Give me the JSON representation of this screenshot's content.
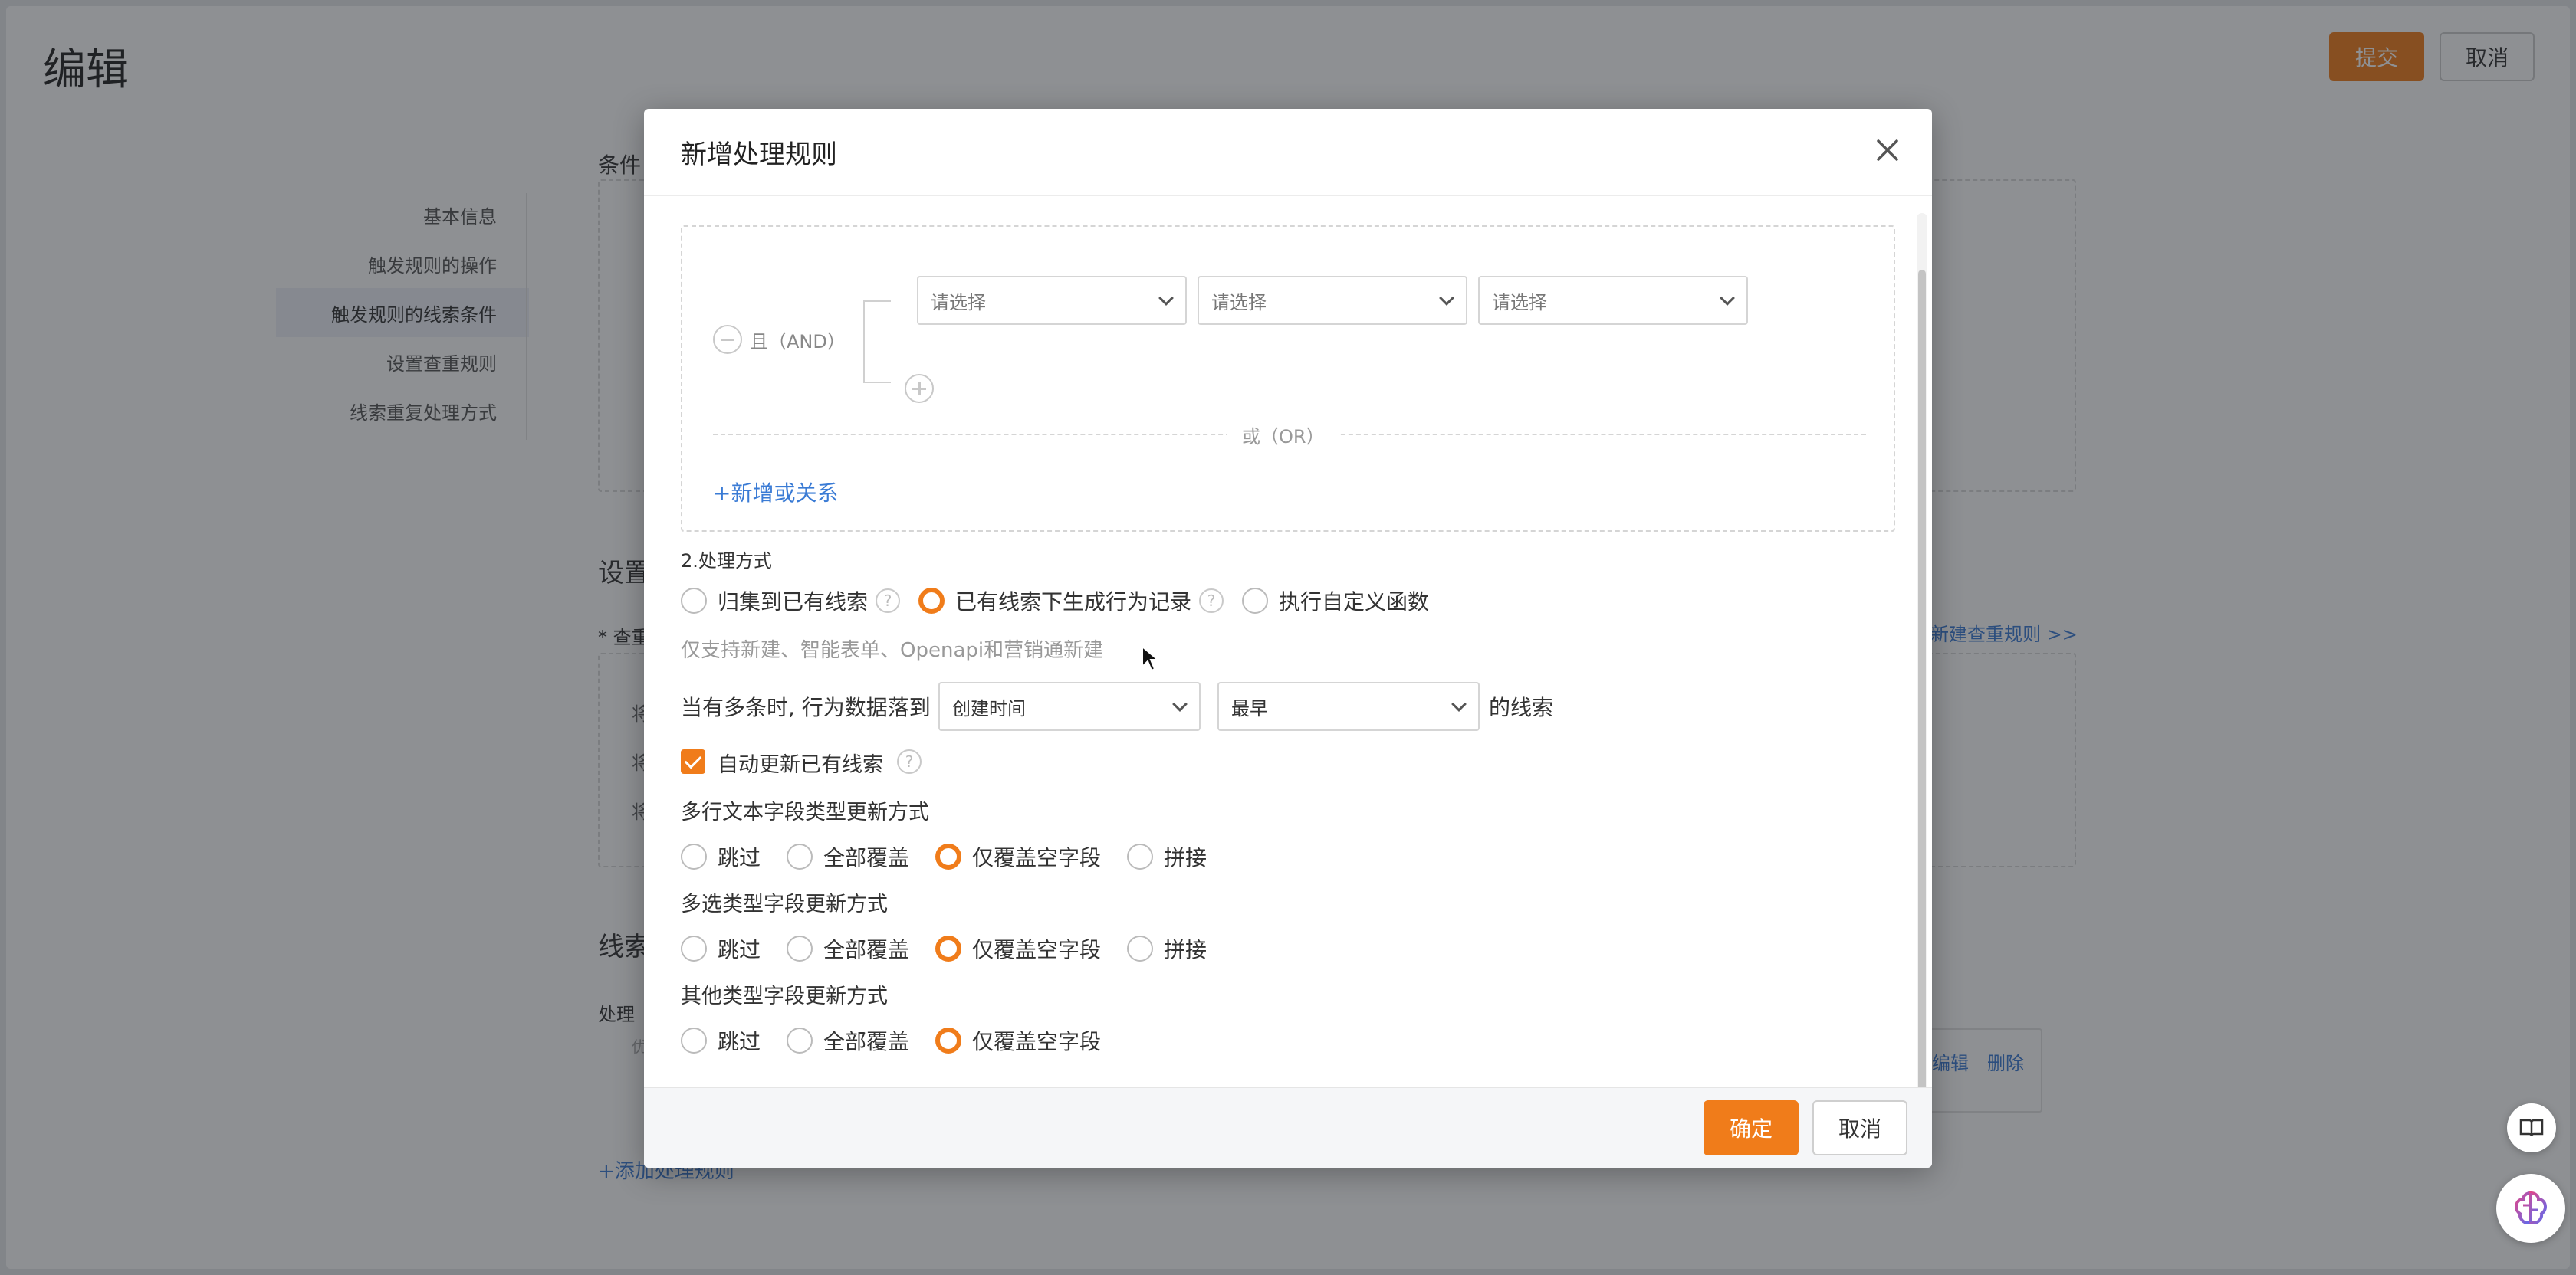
{
  "page": {
    "title": "编辑",
    "submit_label": "提交",
    "cancel_label": "取消"
  },
  "sidebar": {
    "items": [
      {
        "label": "基本信息"
      },
      {
        "label": "触发规则的操作"
      },
      {
        "label": "触发规则的线索条件"
      },
      {
        "label": "设置查重规则"
      },
      {
        "label": "线索重复处理方式"
      }
    ]
  },
  "background": {
    "cond_label": "条件",
    "settings_label": "设置",
    "dedupe_label": "* 查重",
    "new_dedupe_link": "新建查重规则 >>",
    "rows": [
      "将",
      "将",
      "将"
    ],
    "lead_label": "线索",
    "process_label": "处理",
    "process_sub": "优",
    "edit_link": "编辑",
    "delete_link": "删除",
    "add_rule_link": "+添加处理规则"
  },
  "modal": {
    "title": "新增处理规则",
    "condition": {
      "and_label": "且（AND）",
      "selects": [
        "请选择",
        "请选择",
        "请选择"
      ],
      "or_label": "或（OR）",
      "add_or_link": "+新增或关系"
    },
    "section2_title": "2.处理方式",
    "method_options": [
      {
        "label": "归集到已有线索",
        "help": true,
        "checked": false
      },
      {
        "label": "已有线索下生成行为记录",
        "help": true,
        "checked": true
      },
      {
        "label": "执行自定义函数",
        "help": false,
        "checked": false
      }
    ],
    "hint": "仅支持新建、智能表单、Openapi和营销通新建",
    "multi_prefix": "当有多条时, 行为数据落到",
    "select_time": "创建时间",
    "select_order": "最早",
    "multi_suffix": "的线索",
    "auto_update_label": "自动更新已有线索",
    "groups": [
      {
        "title": "多行文本字段类型更新方式",
        "options": [
          {
            "label": "跳过",
            "checked": false
          },
          {
            "label": "全部覆盖",
            "checked": false
          },
          {
            "label": "仅覆盖空字段",
            "checked": true
          },
          {
            "label": "拼接",
            "checked": false
          }
        ]
      },
      {
        "title": "多选类型字段更新方式",
        "options": [
          {
            "label": "跳过",
            "checked": false
          },
          {
            "label": "全部覆盖",
            "checked": false
          },
          {
            "label": "仅覆盖空字段",
            "checked": true
          },
          {
            "label": "拼接",
            "checked": false
          }
        ]
      },
      {
        "title": "其他类型字段更新方式",
        "options": [
          {
            "label": "跳过",
            "checked": false
          },
          {
            "label": "全部覆盖",
            "checked": false
          },
          {
            "label": "仅覆盖空字段",
            "checked": true
          }
        ]
      }
    ],
    "ok_label": "确定",
    "cancel_label": "取消"
  },
  "colors": {
    "accent": "#f07c1a",
    "link": "#3a7bd5"
  },
  "icons": {
    "close": "close-icon",
    "help": "help-icon",
    "book": "book-icon",
    "assistant": "brain-icon"
  }
}
